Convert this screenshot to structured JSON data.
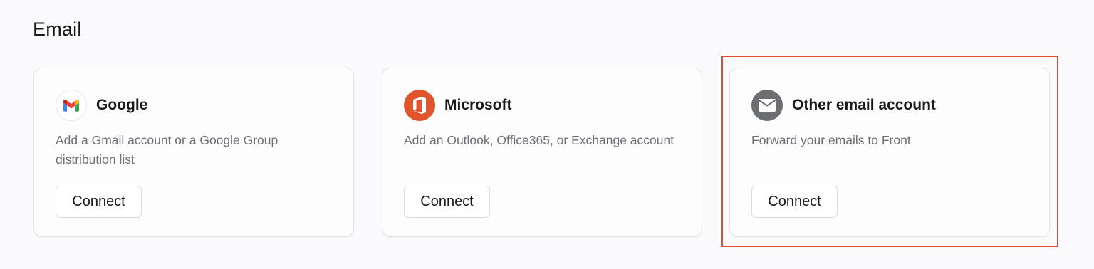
{
  "section": {
    "title": "Email"
  },
  "providers": [
    {
      "name": "Google",
      "description": "Add a Gmail account or a Google Group distribution list",
      "button_label": "Connect",
      "icon": "gmail-icon"
    },
    {
      "name": "Microsoft",
      "description": "Add an Outlook, Office365, or Exchange account",
      "button_label": "Connect",
      "icon": "office-icon"
    },
    {
      "name": "Other email account",
      "description": "Forward your emails to Front",
      "button_label": "Connect",
      "icon": "envelope-icon"
    }
  ],
  "colors": {
    "highlight": "#e14b2d",
    "microsoft_brand": "#e0552b",
    "other_icon_bg": "#6d6e72"
  }
}
